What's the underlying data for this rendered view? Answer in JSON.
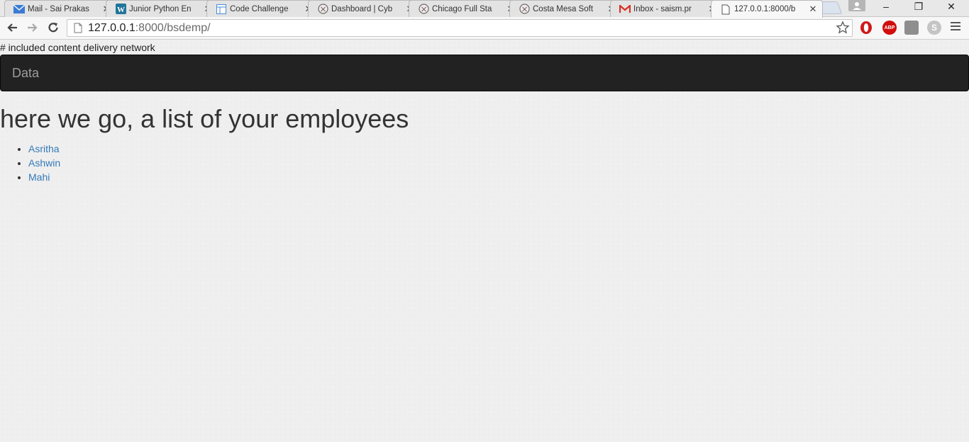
{
  "browser": {
    "tabs": [
      {
        "title": "Mail - Sai Prakas",
        "icon": "mail-icon",
        "color": "#3a7bd5"
      },
      {
        "title": "Junior Python En",
        "icon": "wordpress-icon",
        "color": "#21759b"
      },
      {
        "title": "Code Challenge",
        "icon": "document-icon",
        "color": "#4a8ad6"
      },
      {
        "title": "Dashboard | Cyb",
        "icon": "smiley-icon",
        "color": "#6b6b6b"
      },
      {
        "title": "Chicago Full Sta",
        "icon": "smiley-icon",
        "color": "#6b6b6b"
      },
      {
        "title": "Costa Mesa Soft",
        "icon": "smiley-icon",
        "color": "#6b6b6b"
      },
      {
        "title": "Inbox - saism.pr",
        "icon": "gmail-icon",
        "color": "#d93025"
      },
      {
        "title": "127.0.0.1:8000/b",
        "icon": "page-icon",
        "color": "#555555"
      }
    ],
    "window_controls": {
      "minimize": "–",
      "maximize": "❐",
      "close": "✕"
    },
    "address": {
      "host": "127.0.0.1",
      "path": ":8000/bsdemp/"
    },
    "extensions": {
      "abp_label": "ABP",
      "skype_label": "S"
    }
  },
  "page": {
    "comment": "# included content delivery network",
    "navbar_brand": "Data",
    "heading": "here we go, a list of your employees",
    "employees": [
      "Asritha",
      "Ashwin",
      "Mahi"
    ]
  }
}
